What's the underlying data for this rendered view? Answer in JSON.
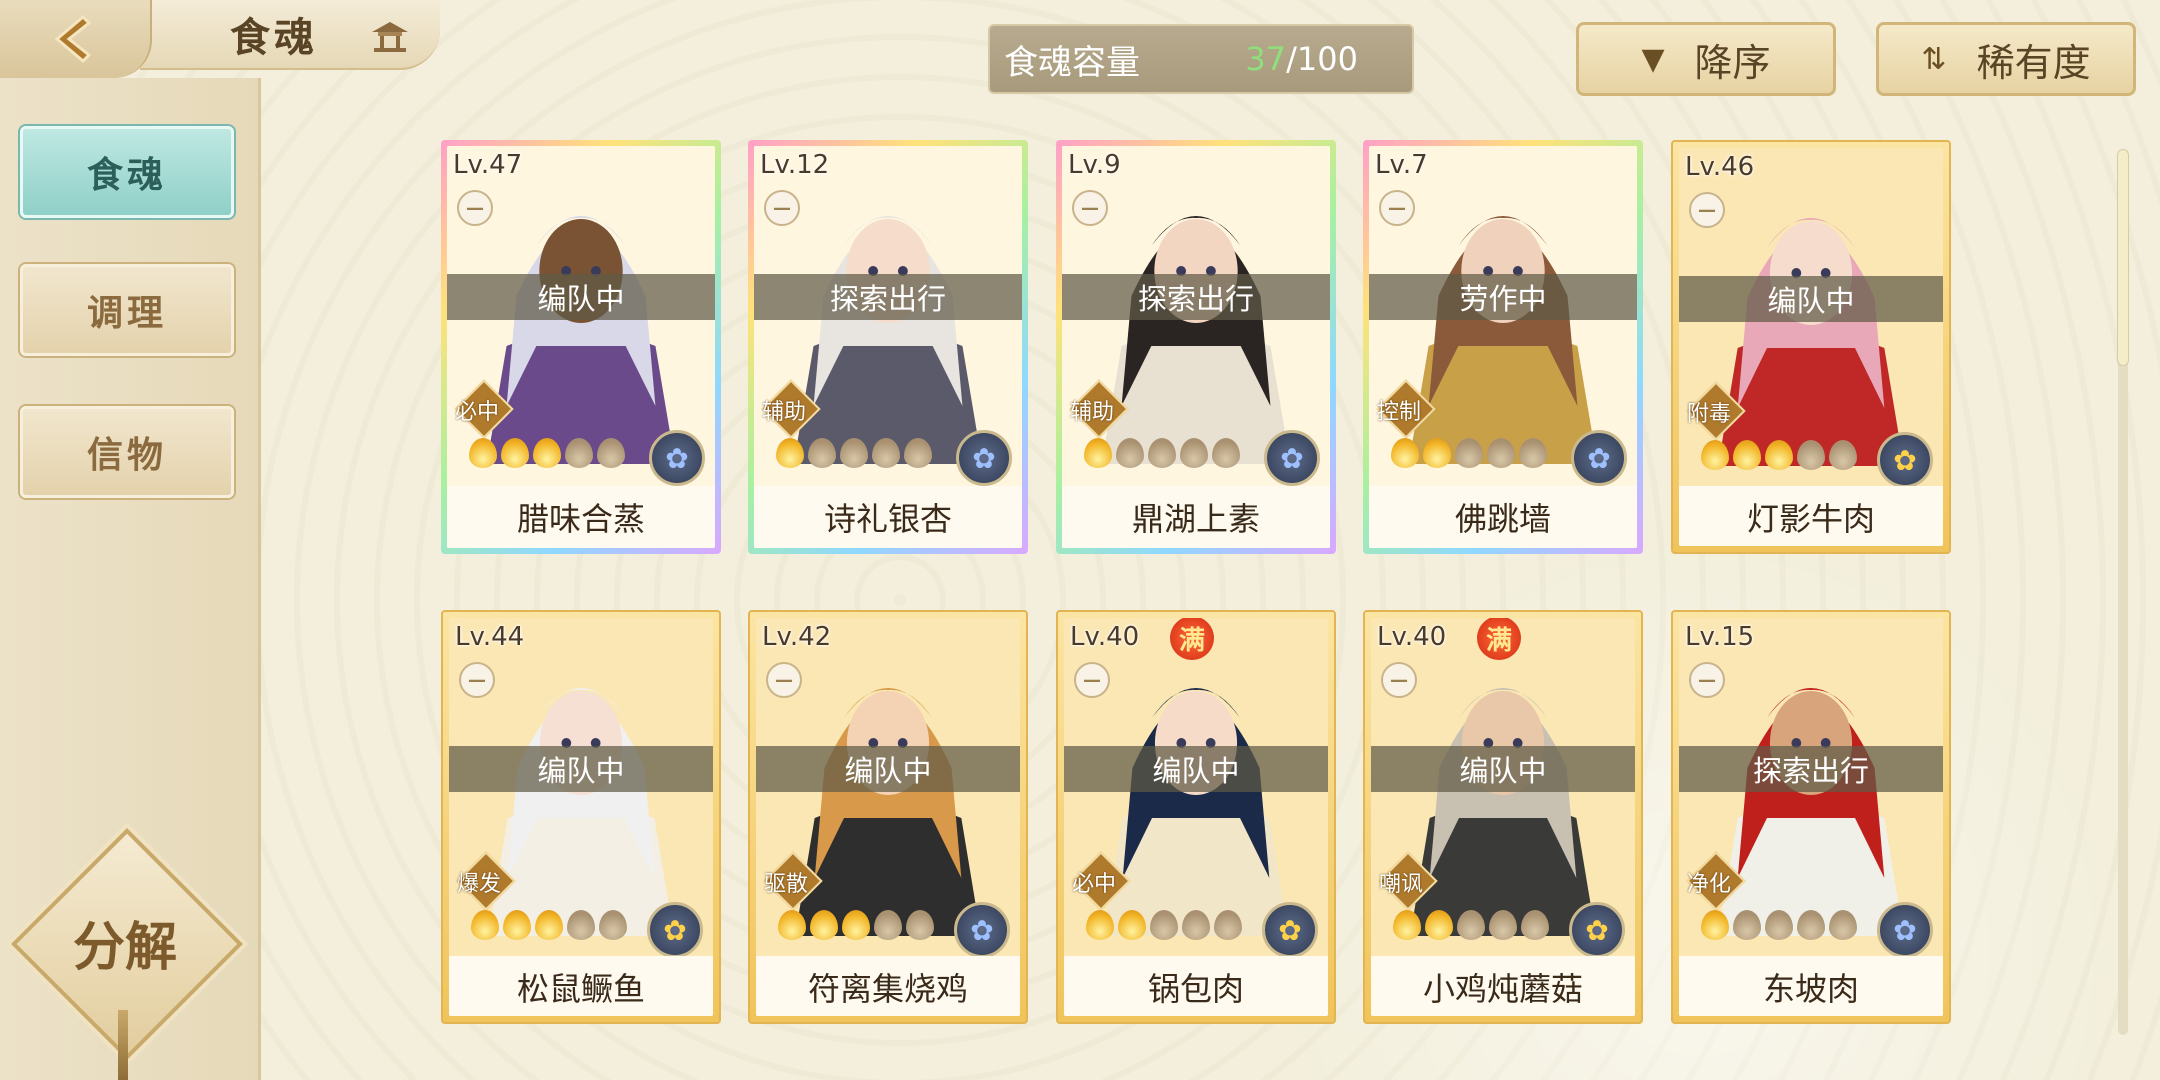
{
  "header": {
    "title": "食魂"
  },
  "sidebar": {
    "items": [
      {
        "label": "食魂",
        "active": true
      },
      {
        "label": "调理",
        "active": false
      },
      {
        "label": "信物",
        "active": false
      }
    ],
    "decompose_label": "分解"
  },
  "capacity": {
    "label": "食魂容量",
    "current": "37",
    "max": "/100"
  },
  "sort": {
    "order_label": "降序",
    "rarity_label": "稀有度"
  },
  "cards": [
    {
      "level": "Lv.47",
      "status": "编队中",
      "role": "必中",
      "name": "腊味合蒸",
      "stars_filled": 3,
      "stars_total": 5,
      "frame": "rainbow",
      "full": false,
      "element": "blue"
    },
    {
      "level": "Lv.12",
      "status": "探索出行",
      "role": "辅助",
      "name": "诗礼银杏",
      "stars_filled": 1,
      "stars_total": 5,
      "frame": "rainbow",
      "full": false,
      "element": "blue"
    },
    {
      "level": "Lv.9",
      "status": "探索出行",
      "role": "辅助",
      "name": "鼎湖上素",
      "stars_filled": 1,
      "stars_total": 5,
      "frame": "rainbow",
      "full": false,
      "element": "blue"
    },
    {
      "level": "Lv.7",
      "status": "劳作中",
      "role": "控制",
      "name": "佛跳墙",
      "stars_filled": 2,
      "stars_total": 5,
      "frame": "rainbow",
      "full": false,
      "element": "blue"
    },
    {
      "level": "Lv.46",
      "status": "编队中",
      "role": "附毒",
      "name": "灯影牛肉",
      "stars_filled": 3,
      "stars_total": 5,
      "frame": "gold",
      "full": false,
      "element": "gold"
    },
    {
      "level": "Lv.44",
      "status": "编队中",
      "role": "爆发",
      "name": "松鼠鳜鱼",
      "stars_filled": 3,
      "stars_total": 5,
      "frame": "gold",
      "full": false,
      "element": "gold"
    },
    {
      "level": "Lv.42",
      "status": "编队中",
      "role": "驱散",
      "name": "符离集烧鸡",
      "stars_filled": 3,
      "stars_total": 5,
      "frame": "gold",
      "full": false,
      "element": "blue"
    },
    {
      "level": "Lv.40",
      "status": "编队中",
      "role": "必中",
      "name": "锅包肉",
      "stars_filled": 2,
      "stars_total": 5,
      "frame": "gold",
      "full": true,
      "element": "gold"
    },
    {
      "level": "Lv.40",
      "status": "编队中",
      "role": "嘲讽",
      "name": "小鸡炖蘑菇",
      "stars_filled": 2,
      "stars_total": 5,
      "frame": "gold",
      "full": true,
      "element": "gold"
    },
    {
      "level": "Lv.15",
      "status": "探索出行",
      "role": "净化",
      "name": "东坡肉",
      "stars_filled": 1,
      "stars_total": 5,
      "frame": "gold",
      "full": false,
      "element": "blue"
    }
  ],
  "full_badge_label": "满",
  "colors": {
    "accent_teal": "#8fd0c8",
    "gold_frame": "#f0c45a",
    "capacity_current": "#8fe07a"
  }
}
